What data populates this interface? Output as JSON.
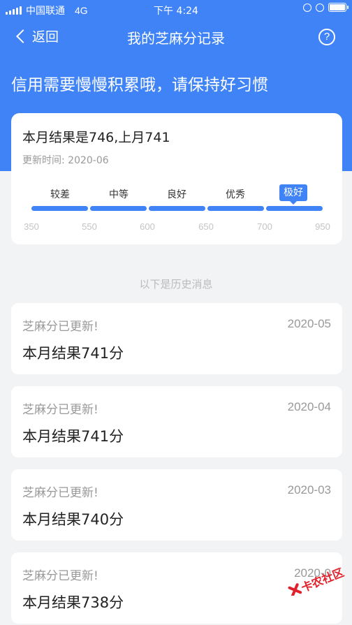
{
  "status_bar": {
    "carrier": "中国联通",
    "network": "4G",
    "time": "下午 4:24"
  },
  "nav": {
    "back_label": "返回",
    "title": "我的芝麻分记录",
    "help_label": "?"
  },
  "hero": {
    "text": "信用需要慢慢积累哦，请保持好习惯"
  },
  "score_card": {
    "title": "本月结果是746,上月741",
    "update_time": "更新时间: 2020-06",
    "levels": [
      "较差",
      "中等",
      "良好",
      "优秀",
      "极好"
    ],
    "active_level": "极好",
    "ticks": [
      "350",
      "550",
      "600",
      "650",
      "700",
      "950"
    ]
  },
  "history_divider": "以下是历史消息",
  "history": [
    {
      "title": "芝麻分已更新!",
      "date": "2020-05",
      "result": "本月结果741分"
    },
    {
      "title": "芝麻分已更新!",
      "date": "2020-04",
      "result": "本月结果741分"
    },
    {
      "title": "芝麻分已更新!",
      "date": "2020-03",
      "result": "本月结果740分"
    },
    {
      "title": "芝麻分已更新!",
      "date": "2020-0",
      "result": "本月结果738分"
    }
  ],
  "watermark": {
    "text": "卡农社区"
  },
  "colors": {
    "primary": "#3f83f6",
    "background": "#f2f3f5",
    "watermark": "#e0202a"
  }
}
